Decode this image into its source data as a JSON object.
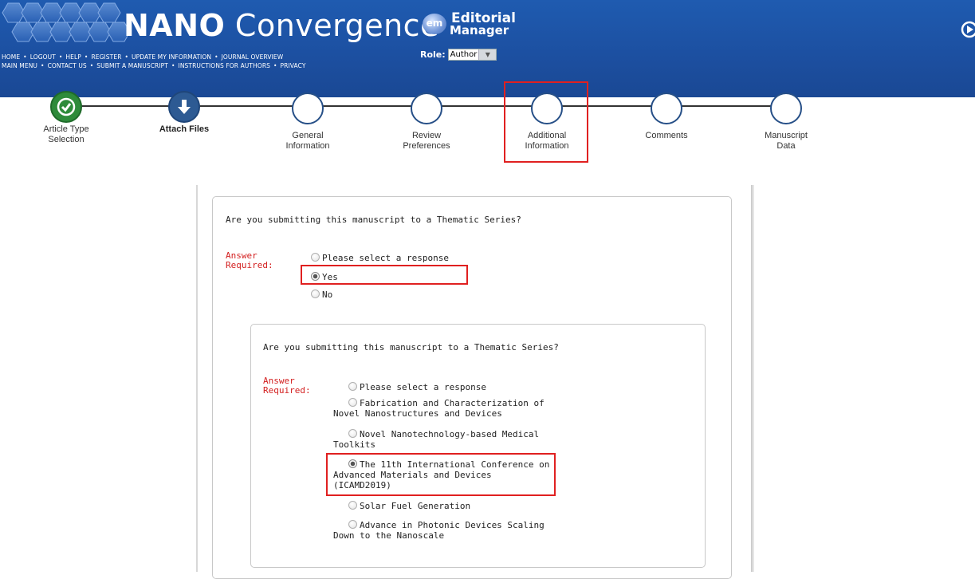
{
  "header": {
    "journal_title_bold": "NANO",
    "journal_title_rest": " Convergence",
    "em_badge": "em",
    "em_line1": "Editorial",
    "em_line2": "Manager",
    "role_label": "Role:",
    "role_value": "Author",
    "nav_row1": [
      "HOME",
      "LOGOUT",
      "HELP",
      "REGISTER",
      "UPDATE MY INFORMATION",
      "JOURNAL OVERVIEW"
    ],
    "nav_row2": [
      "MAIN MENU",
      "CONTACT US",
      "SUBMIT A MANUSCRIPT",
      "INSTRUCTIONS FOR AUTHORS",
      "PRIVACY"
    ],
    "nav_separator": "•",
    "header_color": "#1c4fa0"
  },
  "wizard": {
    "steps": [
      {
        "line1": "Article Type",
        "line2": "Selection",
        "status": "done"
      },
      {
        "line1": "Attach Files",
        "line2": "",
        "status": "current"
      },
      {
        "line1": "General",
        "line2": "Information",
        "status": "pending"
      },
      {
        "line1": "Review",
        "line2": "Preferences",
        "status": "pending"
      },
      {
        "line1": "Additional",
        "line2": "Information",
        "status": "pending"
      },
      {
        "line1": "Comments",
        "line2": "",
        "status": "pending"
      },
      {
        "line1": "Manuscript",
        "line2": "Data",
        "status": "pending"
      }
    ]
  },
  "form": {
    "question1": "Are you submitting this manuscript to a Thematic Series?",
    "answer_required_1": "Answer",
    "answer_required_2": "Required:",
    "options1": [
      "Please select a response",
      "Yes",
      "No"
    ],
    "selected1": "Yes",
    "question2": "Are you submitting this manuscript to a Thematic Series?",
    "options2": [
      {
        "l1": "Please select a response",
        "l2": "",
        "l3": ""
      },
      {
        "l1": "Fabrication and Characterization of",
        "l2": "Novel Nanostructures and Devices",
        "l3": ""
      },
      {
        "l1": "Novel Nanotechnology-based Medical",
        "l2": "Toolkits",
        "l3": ""
      },
      {
        "l1": "The 11th International Conference on",
        "l2": "Advanced Materials and Devices",
        "l3": "(ICAMD2019)"
      },
      {
        "l1": "Solar Fuel Generation",
        "l2": "",
        "l3": ""
      },
      {
        "l1": "Advance in Photonic Devices Scaling",
        "l2": "Down to the Nanoscale",
        "l3": ""
      }
    ],
    "selected2": "The 11th International Conference on Advanced Materials and Devices (ICAMD2019)",
    "required_color": "#d32020",
    "highlight_color": "#e02020"
  }
}
